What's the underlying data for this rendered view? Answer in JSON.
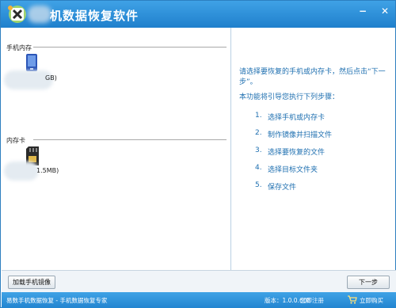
{
  "titlebar": {
    "title": "机数据恢复软件"
  },
  "window_buttons": {
    "minimize": "−",
    "close": "✕"
  },
  "left_panel": {
    "phone_memory_label": "手机内存",
    "phone_memory_size_fragment": "GB)",
    "memory_card_label": "内存卡",
    "memory_card_size_fragment": "1.5MB)"
  },
  "right_panel": {
    "intro": "请选择要恢复的手机或内存卡，然后点击“下一步”。",
    "guide_text": "本功能将引导您执行下列步骤：",
    "steps": [
      {
        "num": "1.",
        "text": "选择手机或内存卡"
      },
      {
        "num": "2.",
        "text": "制作镜像并扫描文件"
      },
      {
        "num": "3.",
        "text": "选择要恢复的文件"
      },
      {
        "num": "4.",
        "text": "选择目标文件夹"
      },
      {
        "num": "5.",
        "text": "保存文件"
      }
    ]
  },
  "buttons": {
    "load_image": "加载手机镜像",
    "next": "下一步"
  },
  "statusbar": {
    "left": "易数手机数据恢复 - 手机数据恢复专家",
    "version": "版本：1.0.0.608",
    "register": "立即注册",
    "buy": "立即购买"
  },
  "icons": {
    "phone": "phone-icon",
    "sd_card": "sd-card-icon",
    "logo": "app-logo-icon",
    "cart": "cart-icon"
  },
  "colors": {
    "titlebar": "#2a8fd8",
    "accent_text": "#1e6fb0"
  }
}
